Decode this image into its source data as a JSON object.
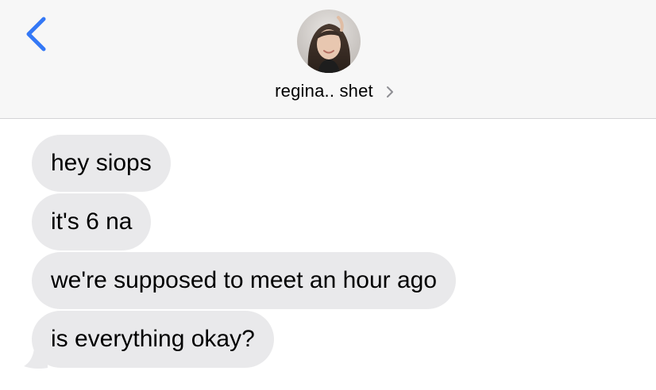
{
  "header": {
    "back_icon": "chevron-left-icon",
    "contact_name": "regina.. shet",
    "contact_chevron_icon": "chevron-right-icon",
    "accent_color": "#3478f6"
  },
  "messages": [
    {
      "text": "hey siops",
      "direction": "incoming"
    },
    {
      "text": "it's 6 na",
      "direction": "incoming"
    },
    {
      "text": "we're supposed to meet an hour ago",
      "direction": "incoming"
    },
    {
      "text": "is everything okay?",
      "direction": "incoming"
    }
  ],
  "colors": {
    "incoming_bubble": "#e9e9eb",
    "header_background": "#f7f7f7"
  }
}
